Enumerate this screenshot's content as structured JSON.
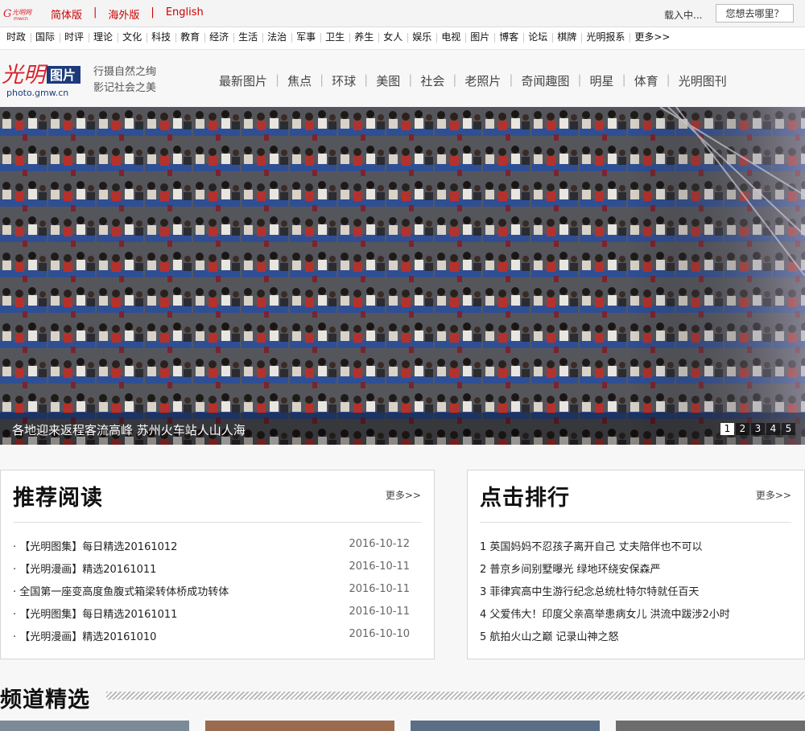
{
  "topbar": {
    "logo_text": "光明网",
    "langs": [
      "简体版",
      "海外版",
      "English"
    ],
    "loading": "载入中...",
    "where_button": "您想去哪里？"
  },
  "nav": [
    "时政",
    "国际",
    "时评",
    "理论",
    "文化",
    "科技",
    "教育",
    "经济",
    "生活",
    "法治",
    "军事",
    "卫生",
    "养生",
    "女人",
    "娱乐",
    "电视",
    "图片",
    "博客",
    "论坛",
    "棋牌",
    "光明报系",
    "更多>>"
  ],
  "header": {
    "logo_text": "光明",
    "logo_badge": "图片",
    "logo_domain": "photo.gmw.cn",
    "slogan_line1": "行摄自然之绚",
    "slogan_line2": "影记社会之美",
    "sections": [
      "最新图片",
      "焦点",
      "环球",
      "美图",
      "社会",
      "老照片",
      "奇闻趣图",
      "明星",
      "体育",
      "光明图刊"
    ]
  },
  "hero": {
    "caption": "各地迎来返程客流高峰 苏州火车站人山人海",
    "pages": [
      "1",
      "2",
      "3",
      "4",
      "5"
    ],
    "active_page": "1"
  },
  "recommended": {
    "title": "推荐阅读",
    "more": "更多>>",
    "items": [
      {
        "text": "· 【光明图集】每日精选20161012",
        "date": "2016-10-12"
      },
      {
        "text": "· 【光明漫画】精选20161011",
        "date": "2016-10-11"
      },
      {
        "text": "· 全国第一座变高度鱼腹式箱梁转体桥成功转体",
        "date": "2016-10-11"
      },
      {
        "text": "· 【光明图集】每日精选20161011",
        "date": "2016-10-11"
      },
      {
        "text": "· 【光明漫画】精选20161010",
        "date": "2016-10-10"
      }
    ]
  },
  "ranking": {
    "title": "点击排行",
    "more": "更多>>",
    "items": [
      "1 英国妈妈不忍孩子离开自己 丈夫陪伴也不可以",
      "2 普京乡间别墅曝光 绿地环绕安保森严",
      "3 菲律宾高中生游行纪念总统杜特尔特就任百天",
      "4 父爱伟大！印度父亲高举患病女儿 洪流中跋涉2小时",
      "5 航拍火山之巅 记录山神之怒"
    ]
  },
  "channel": {
    "title": "频道精选"
  },
  "colors": {
    "accent_red": "#cc0000",
    "logo_red": "#d9232d",
    "badge_blue": "#1d3a7a"
  }
}
